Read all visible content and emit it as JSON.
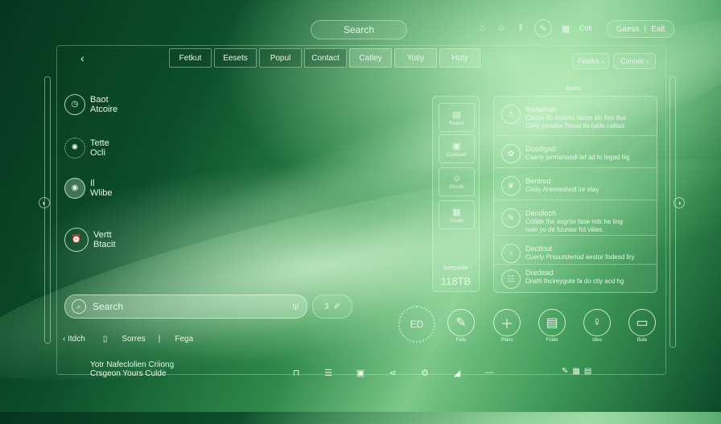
{
  "header": {
    "search_label": "Search",
    "icons": [
      "home-icon",
      "smiley-icon",
      "pause-icon",
      "chat-icon",
      "grid-icon"
    ],
    "grid_label": "Coll",
    "top_button": {
      "left": "Gaess",
      "right": "Ealt"
    }
  },
  "tabs": [
    "Fetkut",
    "Eesets",
    "Popul",
    "Contact",
    "Catley",
    "Yotiy",
    "Hoty"
  ],
  "actions_right": [
    "Feteks",
    "Conner"
  ],
  "left_list": [
    {
      "icon": "clock-icon",
      "line1": "Baot",
      "line2": "Atcoire"
    },
    {
      "icon": "sun-icon",
      "line1": "Tette",
      "line2": "Ocli"
    },
    {
      "icon": "globe-icon",
      "line1": "Il",
      "line2": "Wlibe"
    },
    {
      "icon": "alarm-clock-icon",
      "line1": "Vertt",
      "line2": "Btacit"
    }
  ],
  "side_panel": {
    "items": [
      "Foates",
      "Comicarn",
      "Groote",
      "Crorle"
    ],
    "storage_label": "Seepoidle",
    "storage_value": "118TB"
  },
  "notifications": {
    "header": "Rplins",
    "rows": [
      {
        "title": "Rodaloah",
        "line1": "Cairbe fio bsatiss hatse sin fies tlos",
        "line2": "Celly jorriahs fliteas fis baile caltiss"
      },
      {
        "title": "Dcodlgad",
        "line1": "Caarly jarmanaedl lef ad le fegad liig",
        "line2": ""
      },
      {
        "title": "Bentred",
        "line1": "Cieily Areimestedl lor elay",
        "line2": ""
      },
      {
        "title": "Dendloch",
        "line1": "Cotide fne asgnte fase nds he ling",
        "line2": "nole yo de fountar fot viiles."
      },
      {
        "title": "Dectlout",
        "line1": "Cuerly Prsuutsteriod aestor fodesd liry",
        "line2": ""
      },
      {
        "title": "Dredead",
        "line1": "Dnshl Ihcireygote fa do ctiy acd hg",
        "line2": ""
      }
    ]
  },
  "search_bar": {
    "placeholder": "Search"
  },
  "mini_input": "3",
  "bottom_row": {
    "a": "Itdch",
    "b": "Sorres",
    "c": "Fega"
  },
  "footer": {
    "line1": "Yotr Nafeclolien Criiong",
    "line2": "Crsgeon Yours Culde"
  },
  "action_labels": [
    "Felts",
    "Plans",
    "Folde",
    "Ideo",
    "Bute"
  ],
  "seal_text": "ED"
}
